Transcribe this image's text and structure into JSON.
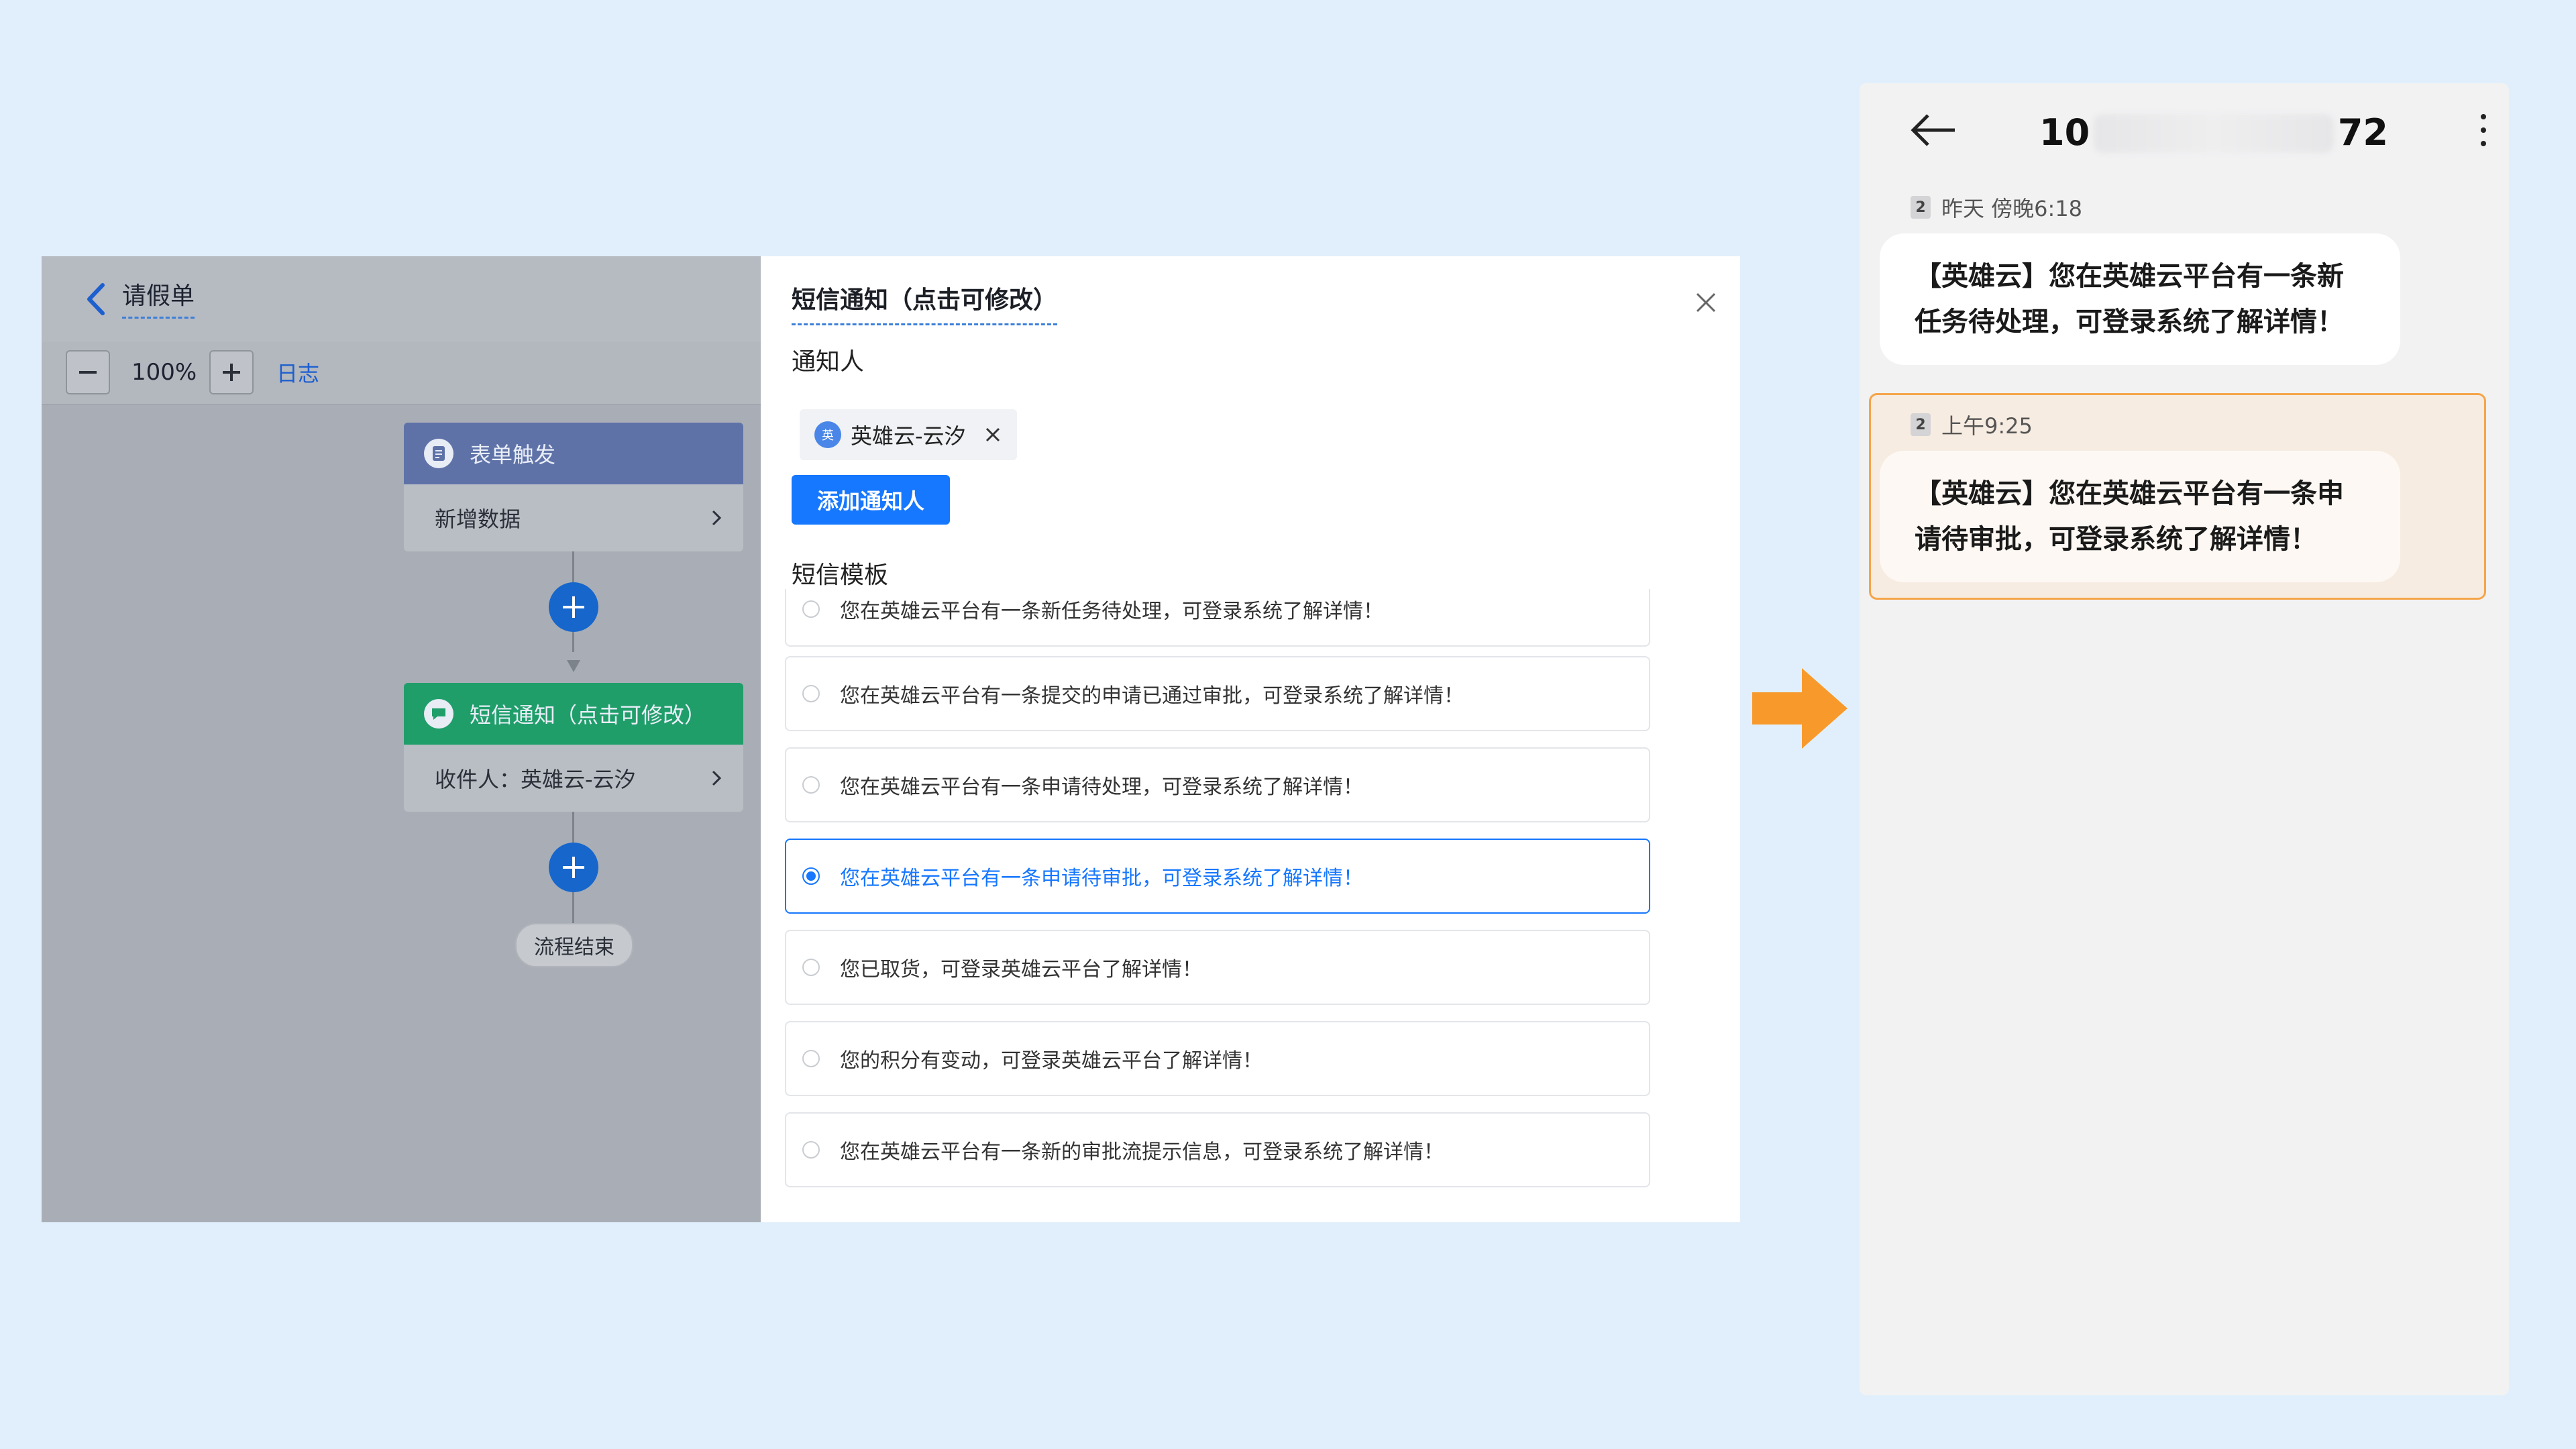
{
  "workflow": {
    "title": "请假单",
    "zoom": "100%",
    "log_label": "日志",
    "nodes": [
      {
        "head": "表单触发",
        "body": "新增数据",
        "color": "#5f72a8"
      },
      {
        "head": "短信通知（点击可修改）",
        "body": "收件人：英雄云-云汐",
        "color": "#1f9e6a"
      }
    ],
    "end_label": "流程结束"
  },
  "modal": {
    "title": "短信通知（点击可修改）",
    "notify_label": "通知人",
    "chip_avatar": "英",
    "chip_name": "英雄云-云汐",
    "add_button": "添加通知人",
    "template_label": "短信模板",
    "templates": [
      "您在英雄云平台有一条新任务待处理，可登录系统了解详情！",
      "您在英雄云平台有一条提交的申请已通过审批，可登录系统了解详情！",
      "您在英雄云平台有一条申请待处理，可登录系统了解详情！",
      "您在英雄云平台有一条申请待审批，可登录系统了解详情！",
      "您已取货，可登录英雄云平台了解详情！",
      "您的积分有变动，可登录英雄云平台了解详情！",
      "您在英雄云平台有一条新的审批流提示信息，可登录系统了解详情！"
    ],
    "selected_index": 3,
    "accent": "#1677ff"
  },
  "phone": {
    "number_prefix": "10",
    "number_suffix": "72",
    "messages": [
      {
        "sim": "2",
        "time": "昨天 傍晚6:18",
        "text_line1": "【英雄云】您在英雄云平台有一条新",
        "text_line2": "任务待处理，可登录系统了解详情！"
      },
      {
        "sim": "2",
        "time": "上午9:25",
        "text_line1": "【英雄云】您在英雄云平台有一条申",
        "text_line2": "请待审批，可登录系统了解详情！"
      }
    ],
    "highlight_color": "#f5a54a"
  },
  "arrow_color": "#f79a2b"
}
